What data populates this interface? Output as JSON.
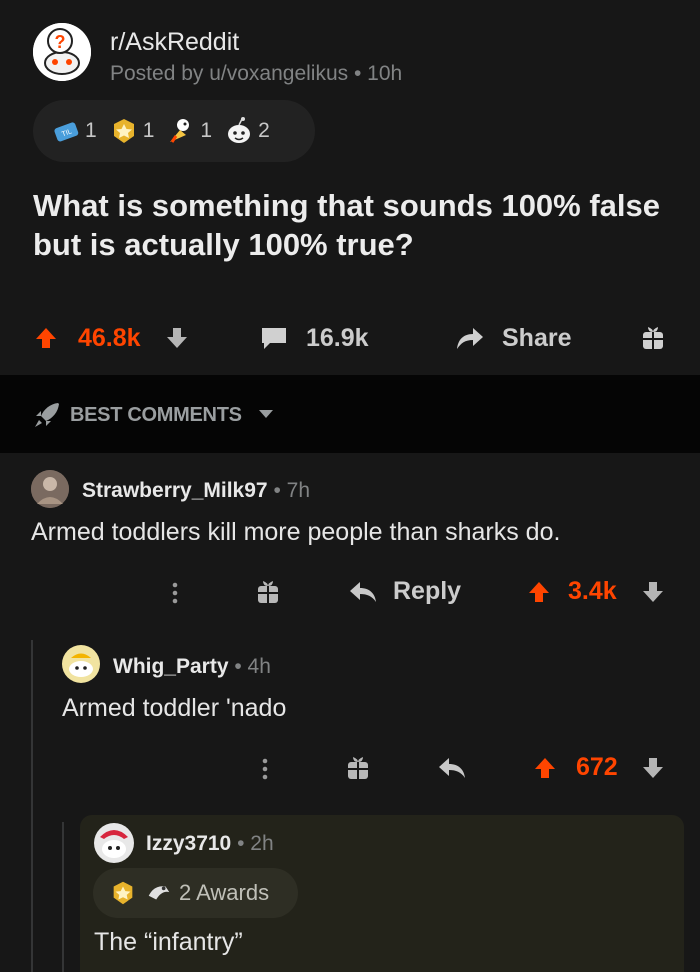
{
  "post": {
    "subreddit": "r/AskReddit",
    "posted_by": "Posted by u/voxangelikus • 10h",
    "awards": [
      {
        "icon": "til-award-icon",
        "count": "1"
      },
      {
        "icon": "gold-award-icon",
        "count": "1"
      },
      {
        "icon": "rocket-award-icon",
        "count": "1"
      },
      {
        "icon": "wholesome-award-icon",
        "count": "2"
      }
    ],
    "title": "What is something that sounds 100% false but is actually 100% true?",
    "upvotes": "46.8k",
    "comments_count": "16.9k",
    "share_label": "Share"
  },
  "sort": {
    "label": "BEST COMMENTS"
  },
  "comments": [
    {
      "author": "Strawberry_Milk97",
      "time": "• 7h",
      "body": "Armed toddlers kill more people than sharks do.",
      "reply_label": "Reply",
      "score": "3.4k"
    },
    {
      "author": "Whig_Party",
      "time": "• 4h",
      "body": "Armed toddler 'nado",
      "score": "672"
    },
    {
      "author": "Izzy3710",
      "time": "• 2h",
      "awards_label": "2 Awards",
      "body": "The “infantry”"
    }
  ],
  "colors": {
    "upvote": "#ff4500",
    "background": "#171717",
    "muted": "#818384"
  }
}
